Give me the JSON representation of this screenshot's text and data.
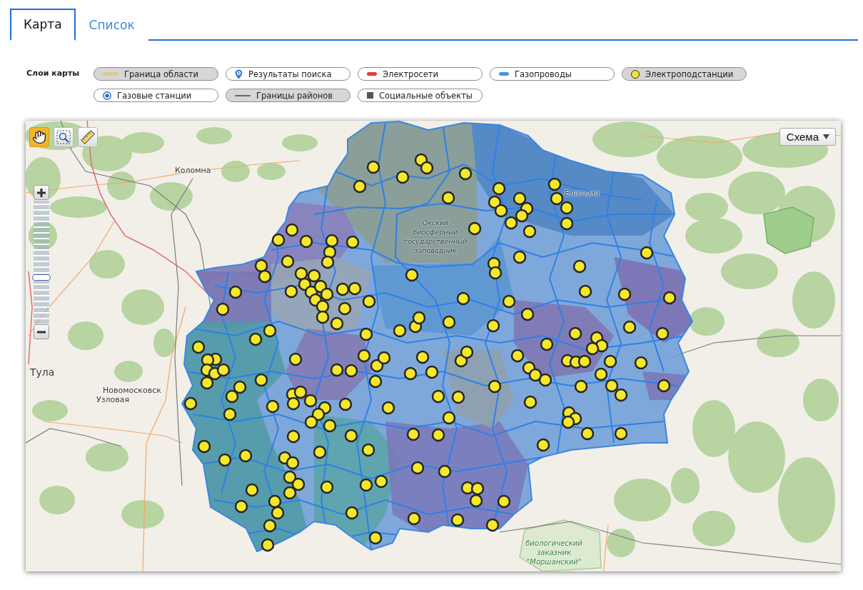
{
  "tabs": [
    {
      "label": "Карта",
      "selected": true
    },
    {
      "label": "Список",
      "selected": false
    }
  ],
  "layers_title": "Слои карты",
  "layers": [
    {
      "label": "Граница области",
      "kind": "region_border",
      "on": true
    },
    {
      "label": "Результаты поиска",
      "kind": "search_results",
      "on": false
    },
    {
      "label": "Электросети",
      "kind": "power_lines",
      "on": false
    },
    {
      "label": "Газопроводы",
      "kind": "gas_pipelines",
      "on": false
    },
    {
      "label": "Электроподстанции",
      "kind": "substations",
      "on": true
    },
    {
      "label": "Газовые станции",
      "kind": "gas_stations",
      "on": false
    },
    {
      "label": "Границы районов",
      "kind": "district_borders",
      "on": true
    },
    {
      "label": "Социальные объекты",
      "kind": "social_objects",
      "on": false
    }
  ],
  "map": {
    "tools": [
      {
        "kind": "pan",
        "selected": true
      },
      {
        "kind": "zoom_box",
        "selected": false
      },
      {
        "kind": "measure",
        "selected": false
      }
    ],
    "zoom": {
      "level": 0.37
    },
    "base_layer": "Схема",
    "labels": [
      "Коломна",
      "Елатьма",
      "Окский биосферный государственный заповедник",
      "Тула",
      "Новомосковск",
      "Узловая",
      "биологический заказник \"Моршанский\""
    ]
  }
}
